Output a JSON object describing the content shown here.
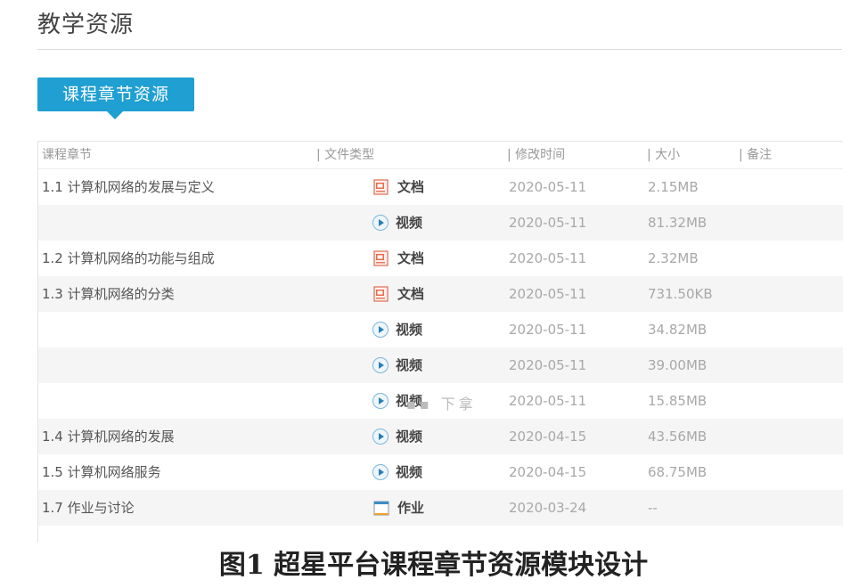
{
  "page": {
    "title": "教学资源",
    "tab_label": "课程章节资源",
    "more_label": "▪▪ 下拿",
    "caption": "图1   超星平台课程章节资源模块设计"
  },
  "table": {
    "headers": {
      "chapter": "课程章节",
      "type": "| 文件类型",
      "date": "| 修改时间",
      "size": "| 大小",
      "note": "| 备注"
    },
    "rows": [
      {
        "chapter": "1.1 计算机网络的发展与定义",
        "type": "文档",
        "icon": "document-icon",
        "date": "2020-05-11",
        "size": "2.15MB"
      },
      {
        "chapter": "",
        "type": "视频",
        "icon": "video-icon",
        "date": "2020-05-11",
        "size": "81.32MB"
      },
      {
        "chapter": "1.2 计算机网络的功能与组成",
        "type": "文档",
        "icon": "document-icon",
        "date": "2020-05-11",
        "size": "2.32MB"
      },
      {
        "chapter": "1.3 计算机网络的分类",
        "type": "文档",
        "icon": "document-icon",
        "date": "2020-05-11",
        "size": "731.50KB"
      },
      {
        "chapter": "",
        "type": "视频",
        "icon": "video-icon",
        "date": "2020-05-11",
        "size": "34.82MB"
      },
      {
        "chapter": "",
        "type": "视频",
        "icon": "video-icon",
        "date": "2020-05-11",
        "size": "39.00MB"
      },
      {
        "chapter": "",
        "type": "视频",
        "icon": "video-icon",
        "date": "2020-05-11",
        "size": "15.85MB"
      },
      {
        "chapter": "1.4 计算机网络的发展",
        "type": "视频",
        "icon": "video-icon",
        "date": "2020-04-15",
        "size": "43.56MB"
      },
      {
        "chapter": "1.5 计算机网络服务",
        "type": "视频",
        "icon": "video-icon",
        "date": "2020-04-15",
        "size": "68.75MB"
      },
      {
        "chapter": "1.7 作业与讨论",
        "type": "作业",
        "icon": "assignment-icon",
        "date": "2020-03-24",
        "size": "--"
      }
    ]
  },
  "colors": {
    "accent": "#1f9fd2",
    "row_alt": "#f5f5f5"
  }
}
